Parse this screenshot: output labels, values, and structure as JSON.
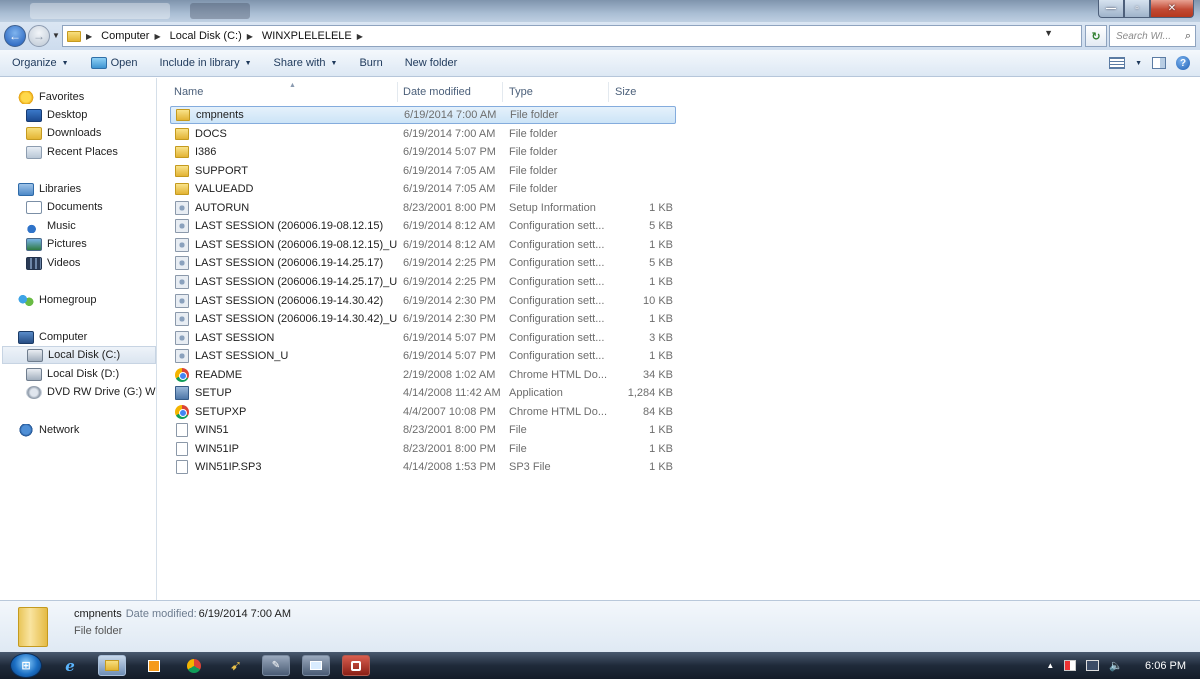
{
  "address": {
    "crumbs": [
      "Computer",
      "Local Disk (C:)",
      "WINXPLELELELE"
    ],
    "search_placeholder": "Search WI..."
  },
  "toolbar": {
    "organize": "Organize",
    "open": "Open",
    "include_in_library": "Include in library",
    "share_with": "Share with",
    "burn": "Burn",
    "new_folder": "New folder"
  },
  "nav": {
    "favorites": "Favorites",
    "desktop": "Desktop",
    "downloads": "Downloads",
    "recent_places": "Recent Places",
    "libraries": "Libraries",
    "documents": "Documents",
    "music": "Music",
    "pictures": "Pictures",
    "videos": "Videos",
    "homegroup": "Homegroup",
    "computer": "Computer",
    "local_c": "Local Disk (C:)",
    "local_d": "Local Disk (D:)",
    "dvd": "DVD RW Drive (G:) WINL",
    "network": "Network"
  },
  "columns": {
    "name": "Name",
    "date_modified": "Date modified",
    "type": "Type",
    "size": "Size"
  },
  "files": [
    {
      "name": "cmpnents",
      "date": "6/19/2014 7:00 AM",
      "type": "File folder",
      "size": "",
      "icon": "folder-icon"
    },
    {
      "name": "DOCS",
      "date": "6/19/2014 7:00 AM",
      "type": "File folder",
      "size": "",
      "icon": "folder-icon"
    },
    {
      "name": "I386",
      "date": "6/19/2014 5:07 PM",
      "type": "File folder",
      "size": "",
      "icon": "folder-icon"
    },
    {
      "name": "SUPPORT",
      "date": "6/19/2014 7:05 AM",
      "type": "File folder",
      "size": "",
      "icon": "folder-icon"
    },
    {
      "name": "VALUEADD",
      "date": "6/19/2014 7:05 AM",
      "type": "File folder",
      "size": "",
      "icon": "folder-icon"
    },
    {
      "name": "AUTORUN",
      "date": "8/23/2001 8:00 PM",
      "type": "Setup Information",
      "size": "1 KB",
      "icon": "settings-file-icon"
    },
    {
      "name": "LAST SESSION (206006.19-08.12.15)",
      "date": "6/19/2014 8:12 AM",
      "type": "Configuration sett...",
      "size": "5 KB",
      "icon": "settings-file-icon"
    },
    {
      "name": "LAST SESSION (206006.19-08.12.15)_U",
      "date": "6/19/2014 8:12 AM",
      "type": "Configuration sett...",
      "size": "1 KB",
      "icon": "settings-file-icon"
    },
    {
      "name": "LAST SESSION (206006.19-14.25.17)",
      "date": "6/19/2014 2:25 PM",
      "type": "Configuration sett...",
      "size": "5 KB",
      "icon": "settings-file-icon"
    },
    {
      "name": "LAST SESSION (206006.19-14.25.17)_U",
      "date": "6/19/2014 2:25 PM",
      "type": "Configuration sett...",
      "size": "1 KB",
      "icon": "settings-file-icon"
    },
    {
      "name": "LAST SESSION (206006.19-14.30.42)",
      "date": "6/19/2014 2:30 PM",
      "type": "Configuration sett...",
      "size": "10 KB",
      "icon": "settings-file-icon"
    },
    {
      "name": "LAST SESSION (206006.19-14.30.42)_U",
      "date": "6/19/2014 2:30 PM",
      "type": "Configuration sett...",
      "size": "1 KB",
      "icon": "settings-file-icon"
    },
    {
      "name": "LAST SESSION",
      "date": "6/19/2014 5:07 PM",
      "type": "Configuration sett...",
      "size": "3 KB",
      "icon": "settings-file-icon"
    },
    {
      "name": "LAST SESSION_U",
      "date": "6/19/2014 5:07 PM",
      "type": "Configuration sett...",
      "size": "1 KB",
      "icon": "settings-file-icon"
    },
    {
      "name": "README",
      "date": "2/19/2008 1:02 AM",
      "type": "Chrome HTML Do...",
      "size": "34 KB",
      "icon": "chrome-icon"
    },
    {
      "name": "SETUP",
      "date": "4/14/2008 11:42 AM",
      "type": "Application",
      "size": "1,284 KB",
      "icon": "application-icon"
    },
    {
      "name": "SETUPXP",
      "date": "4/4/2007 10:08 PM",
      "type": "Chrome HTML Do...",
      "size": "84 KB",
      "icon": "chrome-icon"
    },
    {
      "name": "WIN51",
      "date": "8/23/2001 8:00 PM",
      "type": "File",
      "size": "1 KB",
      "icon": "file-icon"
    },
    {
      "name": "WIN51IP",
      "date": "8/23/2001 8:00 PM",
      "type": "File",
      "size": "1 KB",
      "icon": "file-icon"
    },
    {
      "name": "WIN51IP.SP3",
      "date": "4/14/2008 1:53 PM",
      "type": "SP3 File",
      "size": "1 KB",
      "icon": "file-icon"
    }
  ],
  "details": {
    "name": "cmpnents",
    "date_label": "Date modified:",
    "date_value": "6/19/2014 7:00 AM",
    "type": "File folder"
  },
  "taskbar": {
    "clock": "6:06 PM"
  }
}
